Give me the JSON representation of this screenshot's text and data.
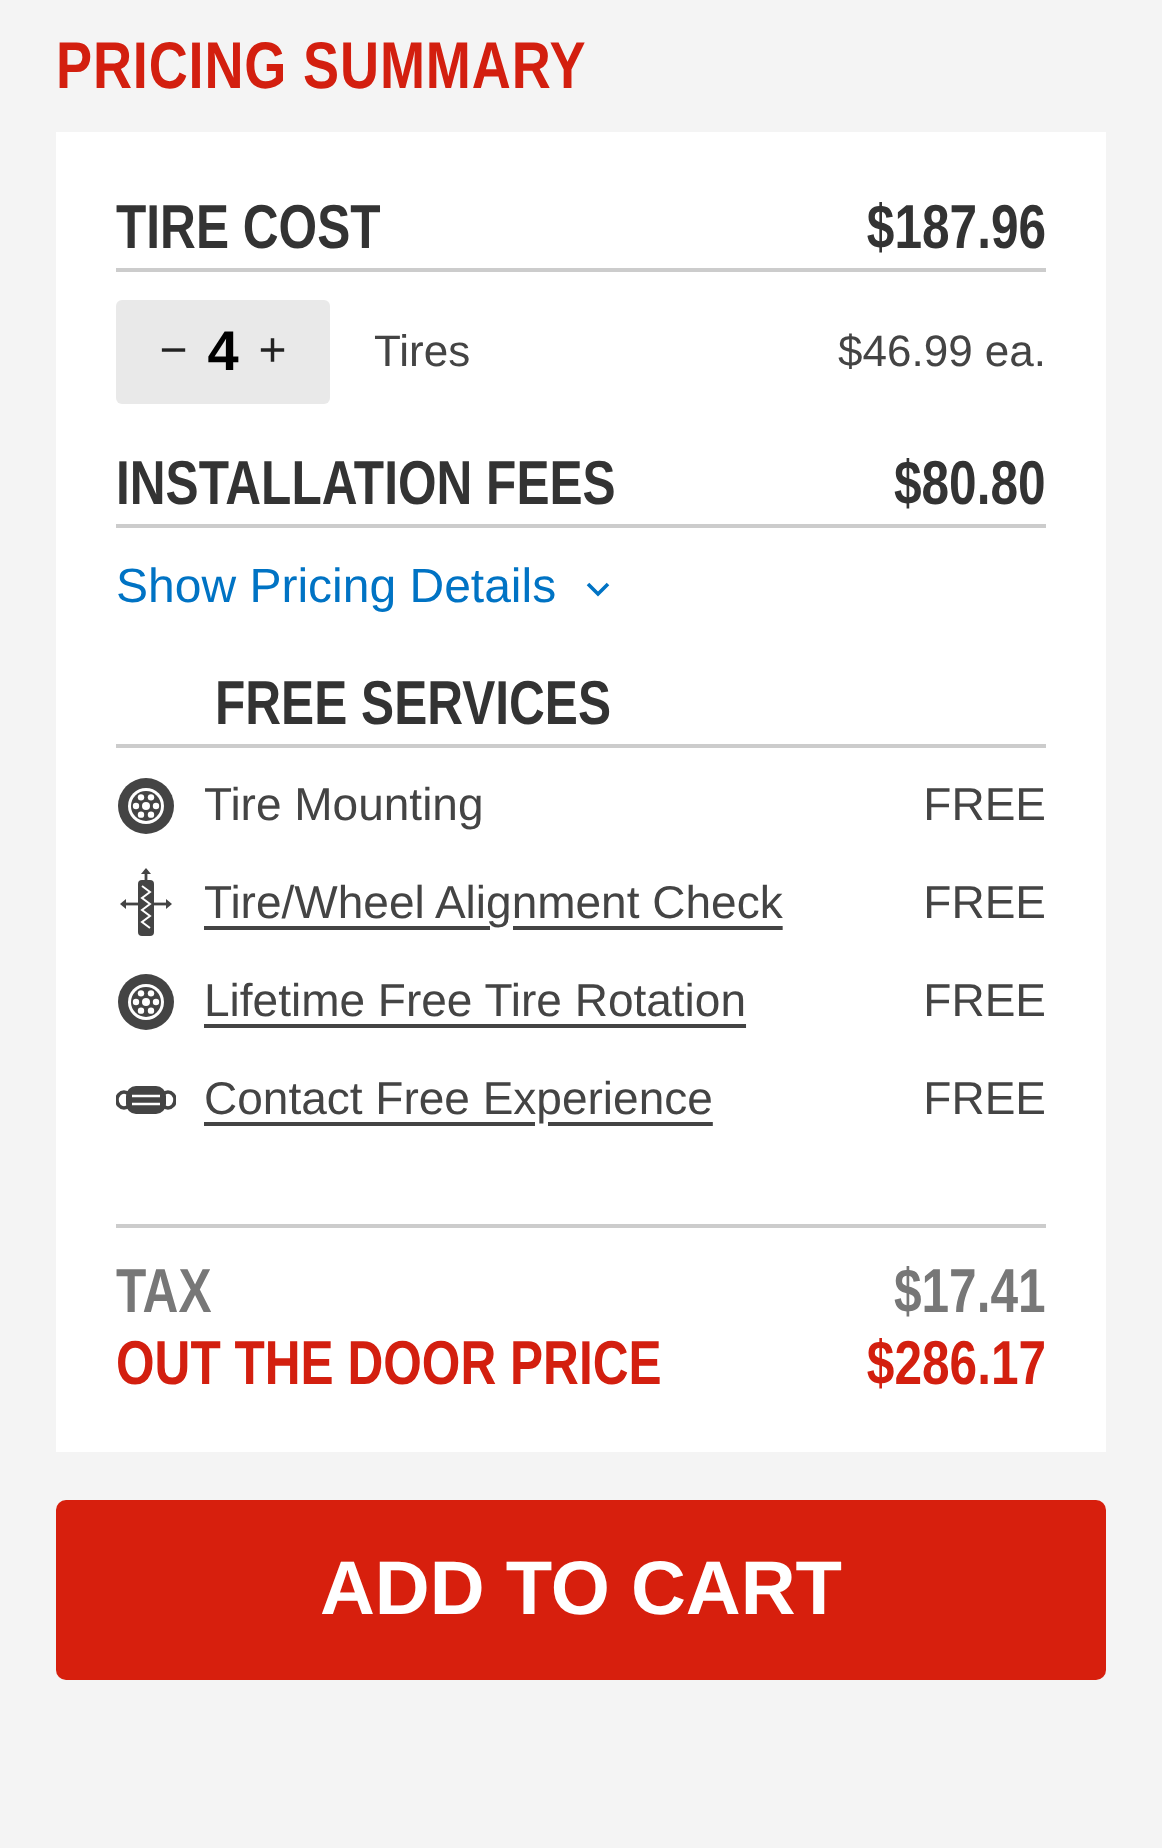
{
  "title": "PRICING SUMMARY",
  "tire_cost": {
    "label": "TIRE COST",
    "amount": "$187.96"
  },
  "quantity": {
    "minus": "−",
    "value": "4",
    "plus": "+",
    "unit": "Tires",
    "each": "$46.99 ea."
  },
  "installation": {
    "label": "INSTALLATION FEES",
    "amount": "$80.80"
  },
  "details_link": {
    "label": "Show Pricing Details",
    "expanded": false
  },
  "free_services": {
    "heading": "FREE SERVICES",
    "items": [
      {
        "kind": "wheel",
        "label": "Tire Mounting",
        "linked": false,
        "price": "FREE"
      },
      {
        "kind": "alignment",
        "label": "Tire/Wheel Alignment Check",
        "linked": true,
        "price": "FREE"
      },
      {
        "kind": "wheel",
        "label": "Lifetime Free Tire Rotation",
        "linked": true,
        "price": "FREE"
      },
      {
        "kind": "mask",
        "label": "Contact Free Experience",
        "linked": true,
        "price": "FREE"
      }
    ]
  },
  "tax": {
    "label": "TAX",
    "amount": "$17.41"
  },
  "total": {
    "label": "OUT THE DOOR PRICE",
    "amount": "$286.17"
  },
  "cart_button": "ADD TO CART"
}
